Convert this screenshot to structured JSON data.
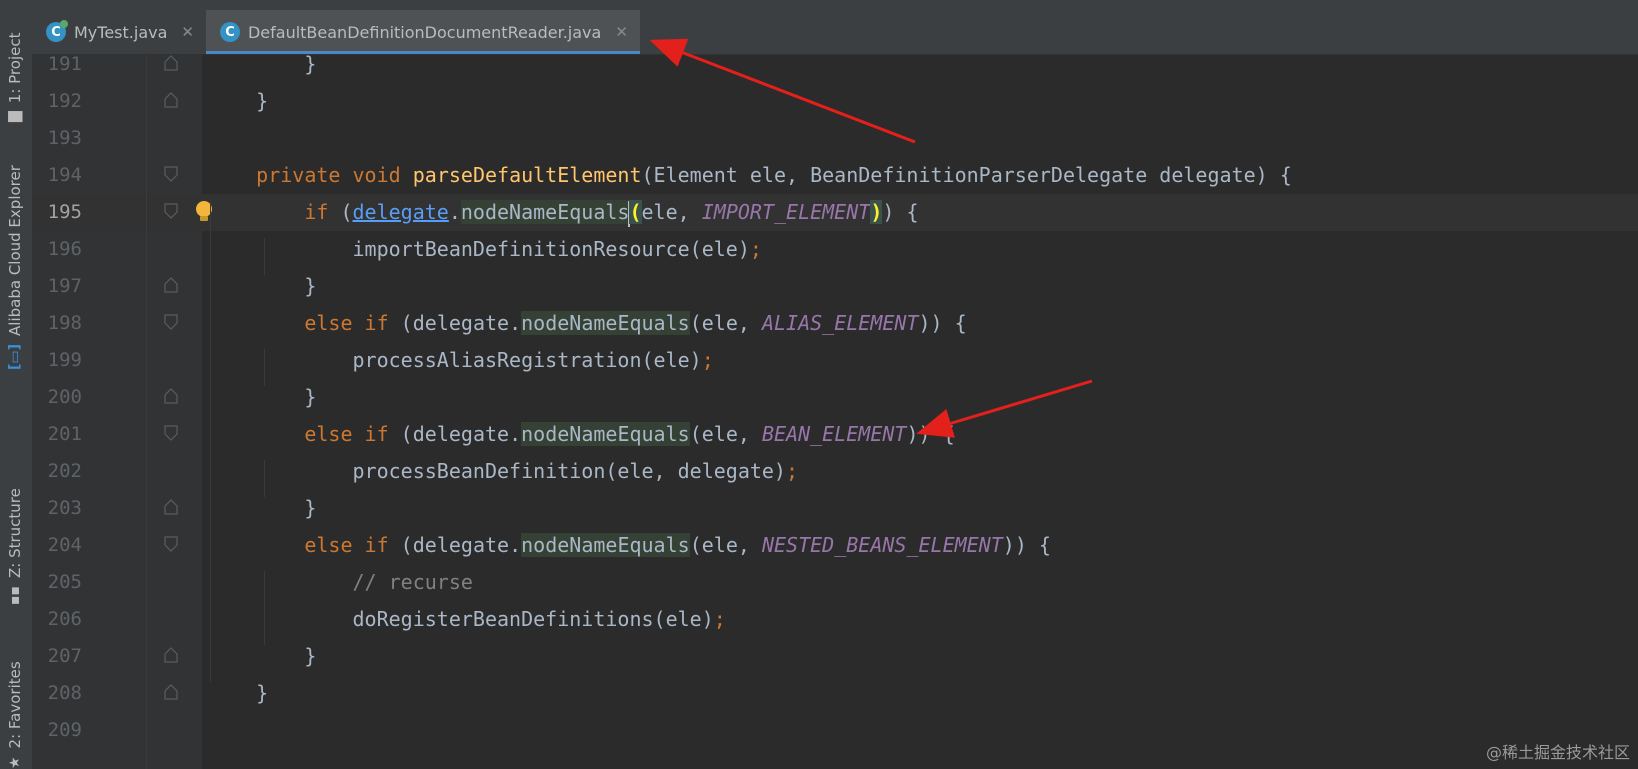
{
  "tool_windows": {
    "project": "1: Project",
    "alibaba": "Alibaba Cloud Explorer",
    "structure": "Z: Structure",
    "favorites": "2: Favorites"
  },
  "tabs": [
    {
      "label": "MyTest.java",
      "active": false
    },
    {
      "label": "DefaultBeanDefinitionDocumentReader.java",
      "active": true
    }
  ],
  "editor": {
    "current_line": "195",
    "lines": [
      {
        "n": "191"
      },
      {
        "n": "192"
      },
      {
        "n": "193"
      },
      {
        "n": "194"
      },
      {
        "n": "195"
      },
      {
        "n": "196"
      },
      {
        "n": "197"
      },
      {
        "n": "198"
      },
      {
        "n": "199"
      },
      {
        "n": "200"
      },
      {
        "n": "201"
      },
      {
        "n": "202"
      },
      {
        "n": "203"
      },
      {
        "n": "204"
      },
      {
        "n": "205"
      },
      {
        "n": "206"
      },
      {
        "n": "207"
      },
      {
        "n": "208"
      },
      {
        "n": "209"
      }
    ],
    "tokens": {
      "private": "private",
      "void": "void",
      "if": "if",
      "else": "else",
      "method": "parseDefaultElement",
      "sig": "(Element ele, BeanDefinitionParserDelegate delegate) {",
      "delegate": "delegate",
      "nodeNameEquals": "nodeNameEquals",
      "ele_arg": "ele, ",
      "import_el": "IMPORT_ELEMENT",
      "alias_el": "ALIAS_ELEMENT",
      "bean_el": "BEAN_ELEMENT",
      "nested_el": "NESTED_BEANS_ELEMENT",
      "importRes": "importBeanDefinitionResource(ele)",
      "processAlias": "processAliasRegistration(ele)",
      "processBean": "processBeanDefinition(ele, delegate)",
      "comment": "// recurse",
      "doRegister": "doRegisterBeanDefinitions(ele)"
    }
  },
  "watermark": "@稀土掘金技术社区",
  "colors": {
    "annotation_arrow": "#e3201b",
    "keyword": "#cc7832",
    "method": "#ffc66d",
    "constant": "#9876aa"
  }
}
